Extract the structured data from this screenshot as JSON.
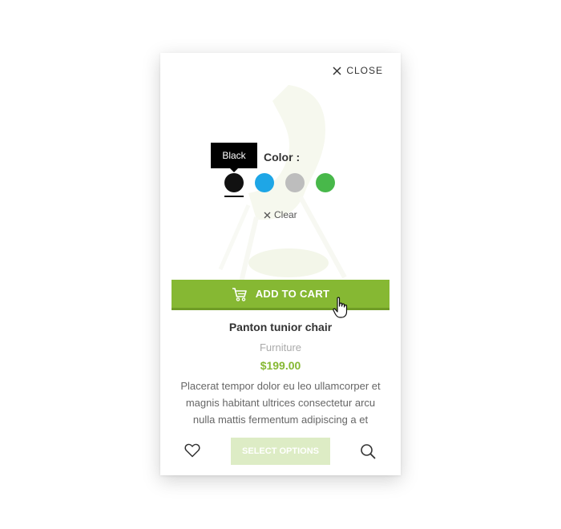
{
  "close": {
    "label": "CLOSE",
    "icon": "close-icon"
  },
  "variation": {
    "label": "Color :",
    "tooltip": "Black",
    "selected": "Black",
    "swatches": [
      {
        "name": "Black",
        "color": "#111111"
      },
      {
        "name": "Blue",
        "color": "#1ea6e6"
      },
      {
        "name": "Gray",
        "color": "#bdbdbd"
      },
      {
        "name": "Green",
        "color": "#48b84a"
      }
    ],
    "clear_label": "Clear"
  },
  "cart": {
    "label": "ADD TO CART",
    "icon": "cart-icon"
  },
  "product": {
    "title": "Panton tunior chair",
    "category": "Furniture",
    "price": "$199.00",
    "description": "Placerat tempor dolor eu leo ullamcorper et magnis habitant ultrices consectetur arcu nulla mattis fermentum adipiscing a et"
  },
  "actions": {
    "select_options_label": "SELECT OPTIONS",
    "wishlist_icon": "heart-icon",
    "search_icon": "search-icon"
  },
  "colors": {
    "accent": "#86b833",
    "select_options_bg": "#ddecc5"
  }
}
